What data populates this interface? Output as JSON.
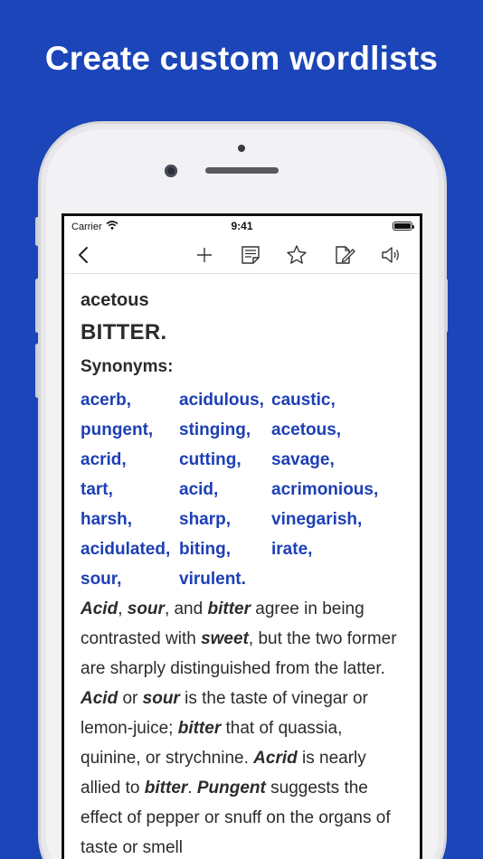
{
  "headline": "Create custom wordlists",
  "status_bar": {
    "carrier": "Carrier",
    "time": "9:41"
  },
  "toolbar": {
    "icons": [
      "back-chevron-icon",
      "add-icon",
      "notes-icon",
      "star-icon",
      "edit-icon",
      "speaker-icon"
    ]
  },
  "entry": {
    "headword": "acetous",
    "definition": "BITTER.",
    "synonyms_label": "Synonyms:",
    "synonyms": [
      "acerb,",
      "acidulous,",
      "caustic,",
      "pungent,",
      "stinging,",
      "acetous,",
      "acrid,",
      "cutting,",
      "savage,",
      "tart,",
      "acid,",
      "acrimonious,",
      "harsh,",
      "sharp,",
      "vinegarish,",
      "acidulated,",
      "biting,",
      "irate,",
      "sour,",
      "virulent."
    ],
    "body": [
      {
        "t": "Acid",
        "b": true
      },
      {
        "t": ", "
      },
      {
        "t": "sour",
        "b": true
      },
      {
        "t": ", and "
      },
      {
        "t": "bitter",
        "b": true
      },
      {
        "t": " agree in being contrasted with "
      },
      {
        "t": "sweet",
        "b": true
      },
      {
        "t": ", but the two former are sharply distinguished from the latter. "
      },
      {
        "t": "Acid",
        "b": true
      },
      {
        "t": " or "
      },
      {
        "t": "sour",
        "b": true
      },
      {
        "t": " is the taste of vinegar or lemon-juice; "
      },
      {
        "t": "bitter",
        "b": true
      },
      {
        "t": " that of quassia, quinine, or strychnine. "
      },
      {
        "t": "Acrid",
        "b": true
      },
      {
        "t": " is nearly allied to "
      },
      {
        "t": "bitter",
        "b": true
      },
      {
        "t": ". "
      },
      {
        "t": "Pungent",
        "b": true
      },
      {
        "t": " suggests the effect of pepper or snuff on the organs of taste or smell"
      }
    ]
  },
  "colors": {
    "background": "#1b45b8",
    "link": "#1d3fb5"
  }
}
